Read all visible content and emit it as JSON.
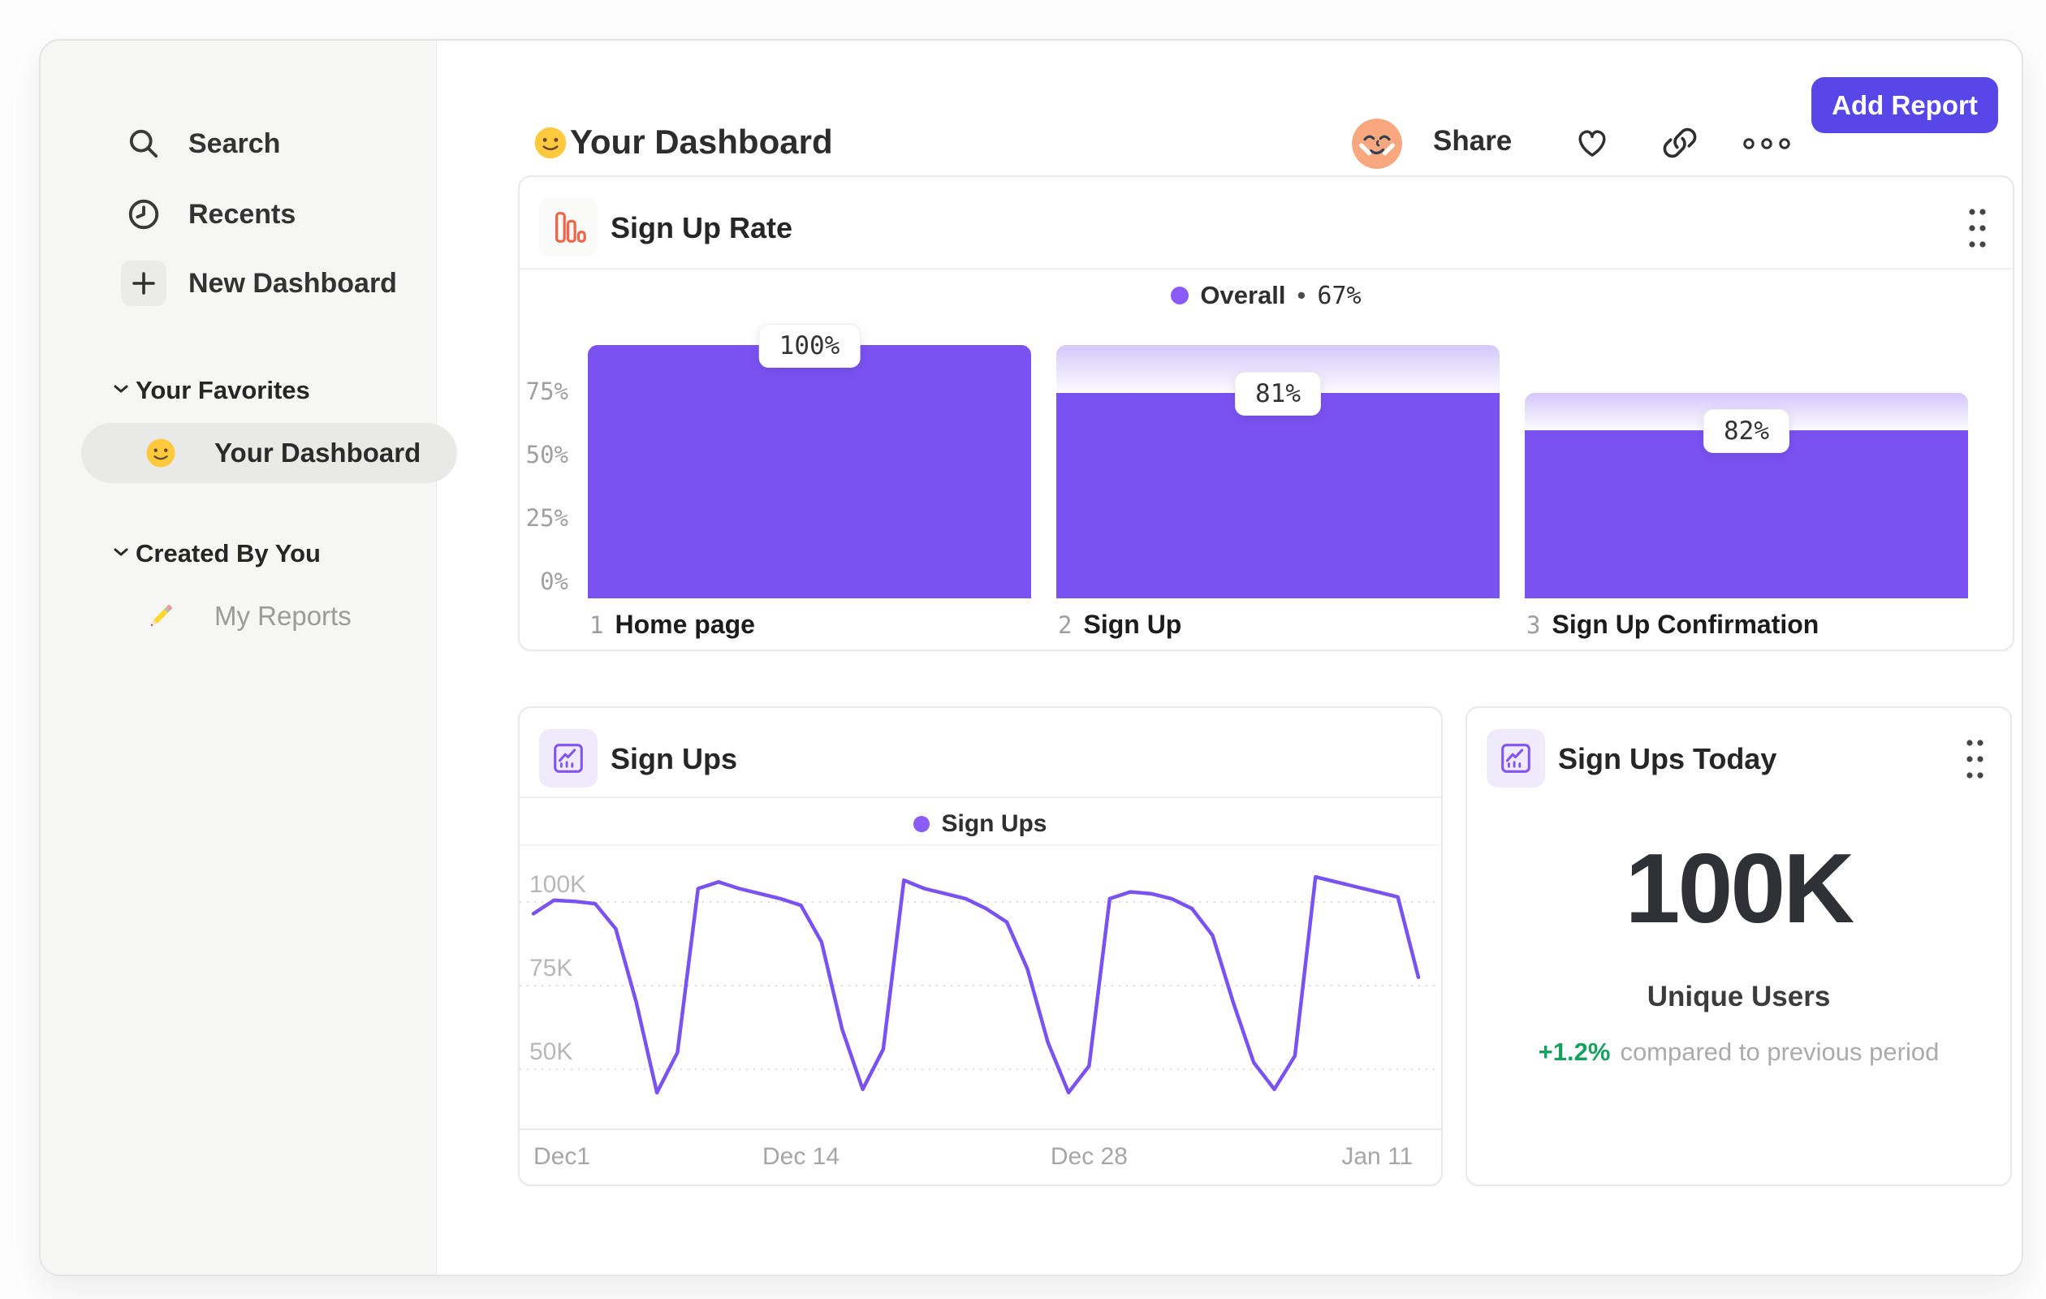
{
  "colors": {
    "accent": "#5847e8",
    "series_purple": "#7b52f2",
    "legend_dot": "#8a5bf6",
    "orange": "#f0654a",
    "green": "#17a05f"
  },
  "sidebar": {
    "nav_items": [
      {
        "label": "Search",
        "icon": "search-icon"
      },
      {
        "label": "Recents",
        "icon": "clock-icon"
      },
      {
        "label": "New Dashboard",
        "icon": "plus-icon"
      }
    ],
    "sections": [
      {
        "title": "Your Favorites",
        "items": [
          {
            "label": "Your Dashboard",
            "icon": "smiley-emoji",
            "selected": true
          }
        ]
      },
      {
        "title": "Created By You",
        "items": [
          {
            "label": "My Reports",
            "icon": "pencil-emoji",
            "selected": false
          }
        ]
      }
    ]
  },
  "header": {
    "title": "Your Dashboard",
    "share": "Share",
    "add_report": "Add Report"
  },
  "funnel_card": {
    "title": "Sign Up Rate",
    "legend_label": "Overall",
    "legend_sep": "•",
    "legend_value": "67%"
  },
  "line_card": {
    "title": "Sign Ups",
    "legend_label": "Sign Ups"
  },
  "metric_card": {
    "title": "Sign Ups Today",
    "value": "100K",
    "label": "Unique Users",
    "delta": "+1.2%",
    "delta_note": "compared to previous period"
  },
  "chart_data": [
    {
      "type": "bar",
      "subtype": "funnel",
      "title": "Sign Up Rate",
      "legend": "Overall",
      "overall_conversion_pct": 67,
      "ylim": [
        0,
        100
      ],
      "yticks_pct": [
        75,
        50,
        25,
        0
      ],
      "steps": [
        {
          "index": 1,
          "category": "Home page",
          "overall_pct": 100,
          "from_pct": 100,
          "label": "100%"
        },
        {
          "index": 2,
          "category": "Sign Up",
          "overall_pct": 81,
          "from_pct": 100,
          "label": "81%"
        },
        {
          "index": 3,
          "category": "Sign Up Confirmation",
          "overall_pct": 66.4,
          "from_pct": 81,
          "label": "82%"
        }
      ]
    },
    {
      "type": "line",
      "title": "Sign Ups",
      "legend": "Sign Ups",
      "unit": "K",
      "ylim_k": [
        30,
        115
      ],
      "yticks_k": [
        100,
        75,
        50
      ],
      "x_ticks": [
        {
          "label": "Dec1",
          "day": 0
        },
        {
          "label": "Dec 14",
          "day": 13
        },
        {
          "label": "Dec 28",
          "day": 27
        },
        {
          "label": "Jan 11",
          "day": 41
        }
      ],
      "days_total": 44,
      "values_k": [
        96.5,
        100.5,
        100.2,
        99.5,
        92,
        70,
        43,
        55,
        104,
        106,
        104,
        102.5,
        101,
        99,
        88,
        62,
        44,
        56,
        106.5,
        104,
        102.5,
        101,
        98,
        94,
        80,
        58,
        43,
        51,
        101,
        103,
        102.5,
        101,
        98,
        90,
        70,
        52,
        44,
        54,
        107.5,
        106,
        104.5,
        103,
        101.5,
        77.5
      ]
    }
  ]
}
